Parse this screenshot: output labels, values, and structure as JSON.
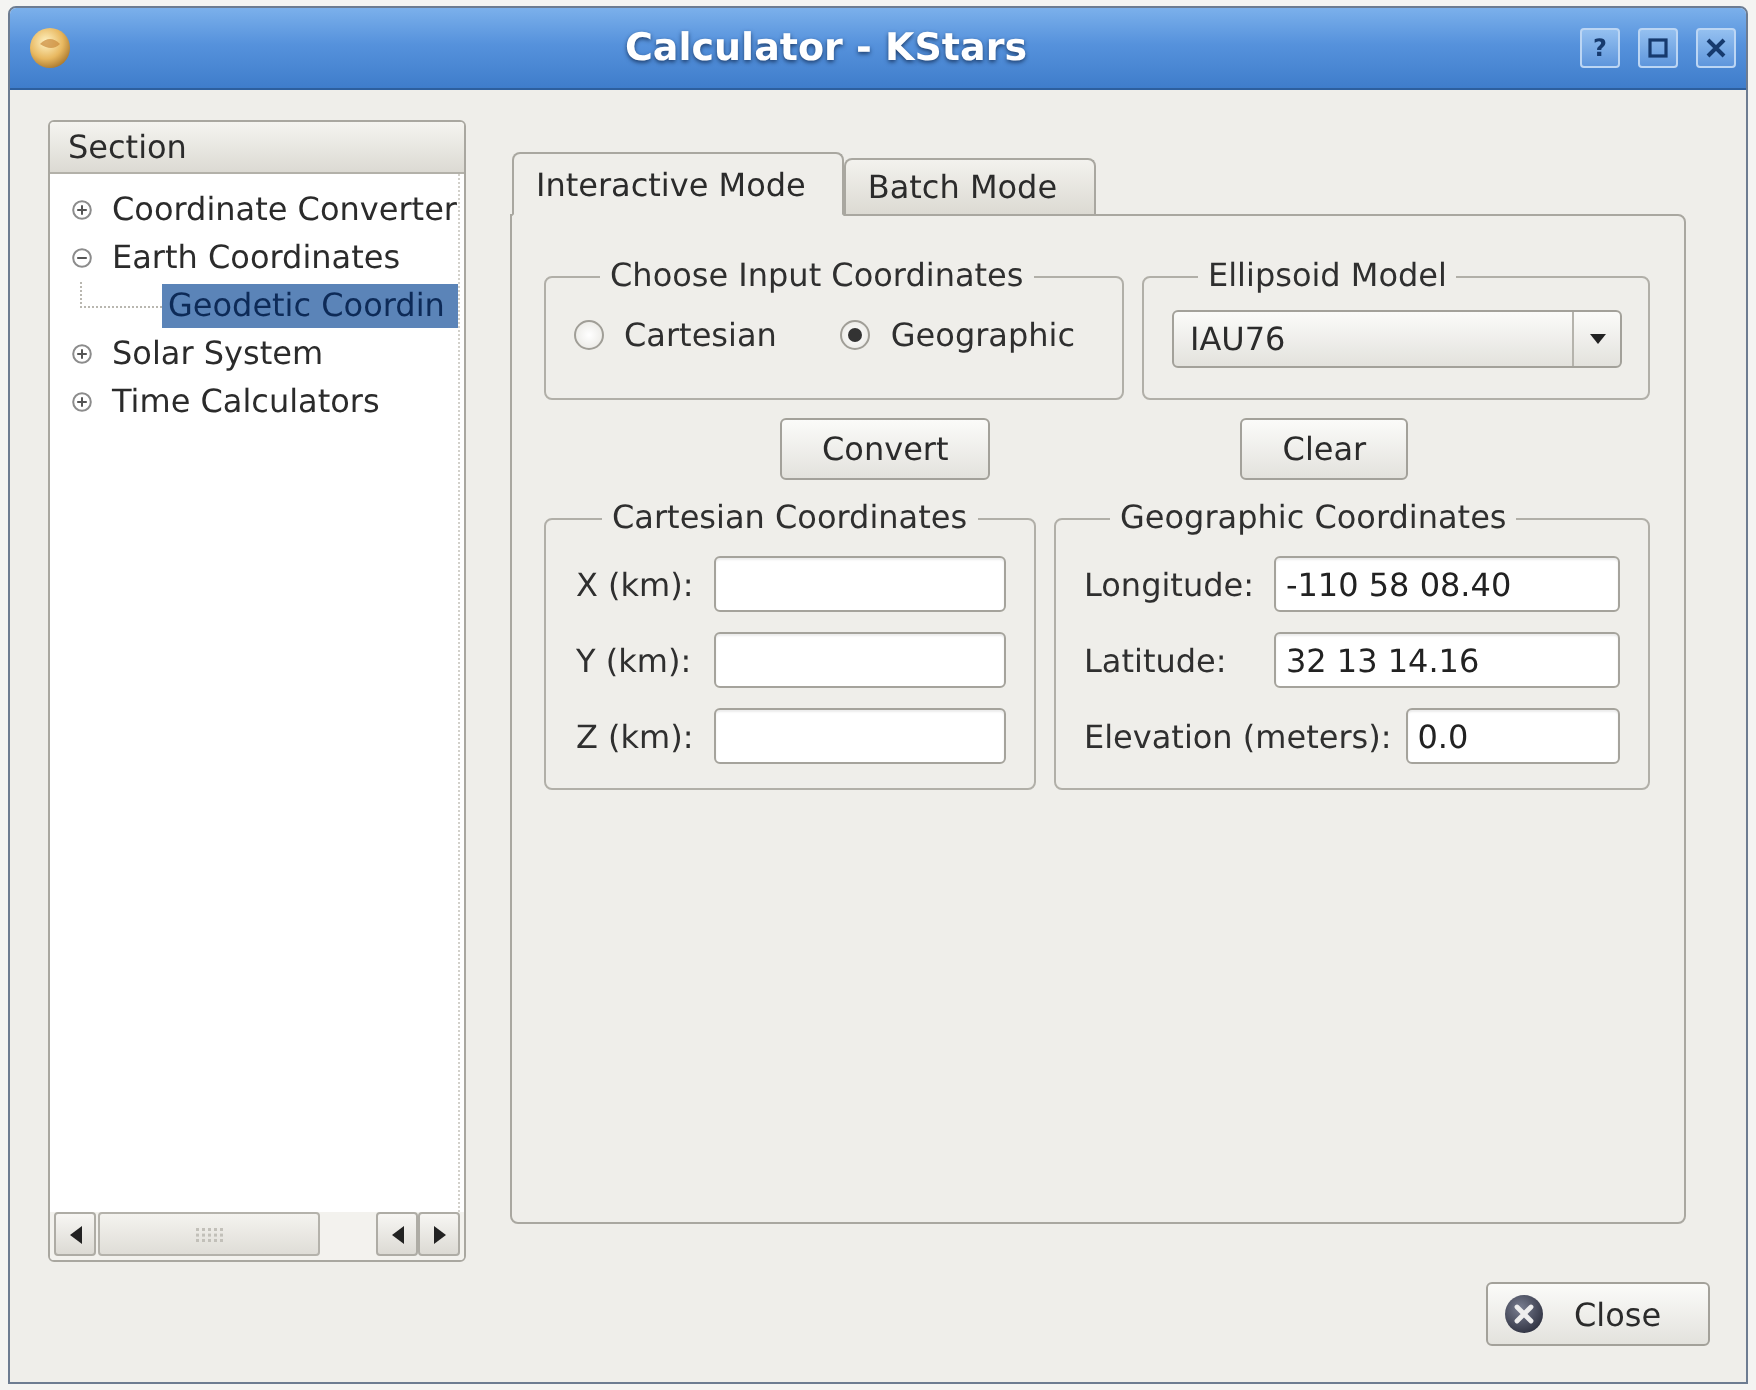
{
  "window": {
    "title": "Calculator - KStars",
    "help_button": "?"
  },
  "sidebar": {
    "header": "Section",
    "items": [
      {
        "label": "Coordinate Converter",
        "expanded": false,
        "selected": false
      },
      {
        "label": "Earth Coordinates",
        "expanded": true,
        "selected": false,
        "children": [
          {
            "label": "Geodetic Coordin",
            "selected": true
          }
        ]
      },
      {
        "label": "Solar System",
        "expanded": false,
        "selected": false
      },
      {
        "label": "Time Calculators",
        "expanded": false,
        "selected": false
      }
    ]
  },
  "tabs": [
    {
      "label": "Interactive Mode",
      "selected": true
    },
    {
      "label": "Batch Mode",
      "selected": false
    }
  ],
  "input_coordinates": {
    "title": "Choose Input Coordinates",
    "options": [
      {
        "label": "Cartesian",
        "selected": false
      },
      {
        "label": "Geographic",
        "selected": true
      }
    ]
  },
  "ellipsoid_model": {
    "title": "Ellipsoid Model",
    "value": "IAU76"
  },
  "actions": [
    {
      "label": "Convert"
    },
    {
      "label": "Clear"
    }
  ],
  "cartesian_coordinates": {
    "title": "Cartesian Coordinates",
    "fields": [
      {
        "label": "X (km):"
      },
      {
        "label": "Y (km):"
      },
      {
        "label": "Z (km):"
      }
    ]
  },
  "geographic_coordinates": {
    "title": "Geographic Coordinates",
    "fields": [
      {
        "label": "Longitude:",
        "value": "-110 58 08.40",
        "kind": "aligned"
      },
      {
        "label": "Latitude:",
        "value": "32 13 14.16",
        "kind": "aligned"
      },
      {
        "label": "Elevation (meters):",
        "value": "0.0",
        "kind": "inline"
      }
    ]
  },
  "footer": {
    "close_button": {
      "label": "Close"
    }
  }
}
